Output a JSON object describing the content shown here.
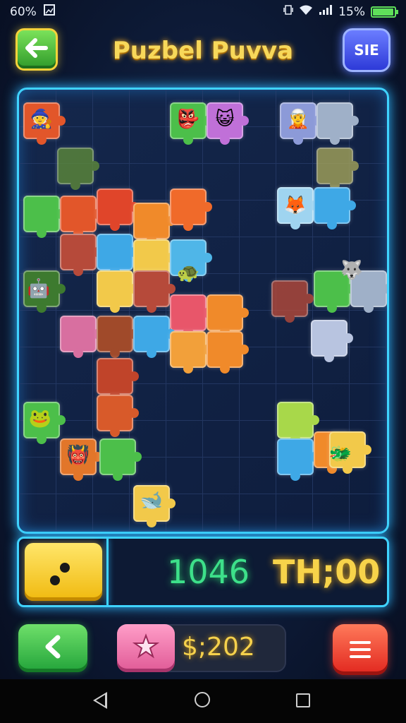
{
  "status_bar": {
    "left_text": "60%",
    "right_text": "15%",
    "battery_level": 0.9
  },
  "header": {
    "title": "Puzbel Puvva",
    "back_icon": "arrow-left-icon",
    "menu_label": "SIE"
  },
  "board": {
    "piece_colors": [
      "#e2562a",
      "#f08a2a",
      "#3ea8e6",
      "#f2c94a",
      "#4cbf4a",
      "#b64a3a",
      "#8c9ad8",
      "#d86fa0",
      "#5e8a3a",
      "#9fb0c8"
    ]
  },
  "info_panel": {
    "score": "1046",
    "timer": "TH;00",
    "dice_icon": "dice-icon"
  },
  "bottom_bar": {
    "prev_icon": "chevron-left-icon",
    "coin_icon": "puzzle-star-icon",
    "coins": "$;202",
    "menu_icon": "hamburger-menu-icon"
  },
  "nav_bar": {
    "back_icon": "nav-back-icon",
    "home_icon": "nav-home-icon",
    "recent_icon": "nav-recent-icon"
  }
}
